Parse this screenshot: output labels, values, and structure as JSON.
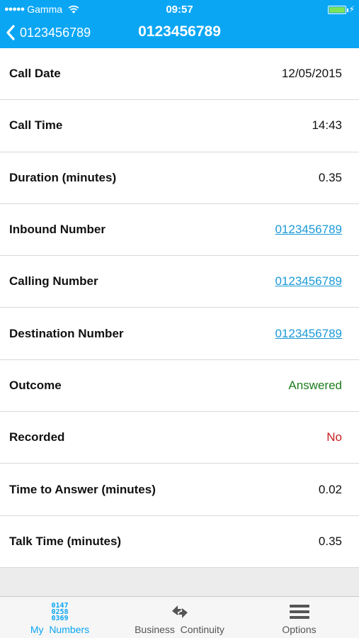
{
  "status_bar": {
    "carrier": "Gamma",
    "signal_dots": "●●●●●",
    "time": "09:57"
  },
  "nav": {
    "back_label": "0123456789",
    "title": "0123456789"
  },
  "rows": [
    {
      "label": "Call Date",
      "value": "12/05/2015",
      "style": "plain"
    },
    {
      "label": "Call Time",
      "value": "14:43",
      "style": "plain"
    },
    {
      "label": "Duration (minutes)",
      "value": "0.35",
      "style": "plain"
    },
    {
      "label": "Inbound Number",
      "value": "0123456789",
      "style": "link"
    },
    {
      "label": "Calling Number",
      "value": "0123456789",
      "style": "link"
    },
    {
      "label": "Destination Number",
      "value": "0123456789",
      "style": "link"
    },
    {
      "label": "Outcome",
      "value": "Answered",
      "style": "green"
    },
    {
      "label": "Recorded",
      "value": "No",
      "style": "red"
    },
    {
      "label": "Time to Answer (minutes)",
      "value": "0.02",
      "style": "plain"
    },
    {
      "label": "Talk Time (minutes)",
      "value": "0.35",
      "style": "plain"
    }
  ],
  "tabs": [
    {
      "label": "My  Numbers",
      "icon": "numbers-grid-icon",
      "active": true,
      "icon_text": [
        "0147",
        "0258",
        "0369"
      ]
    },
    {
      "label": "Business  Continuity",
      "icon": "arrows-swap-icon",
      "active": false
    },
    {
      "label": "Options",
      "icon": "hamburger-menu-icon",
      "active": false
    }
  ],
  "colors": {
    "header": "#0aa6f4",
    "link": "#1b9ad6",
    "answered": "#1e7d1e",
    "no": "#c81e1e"
  }
}
